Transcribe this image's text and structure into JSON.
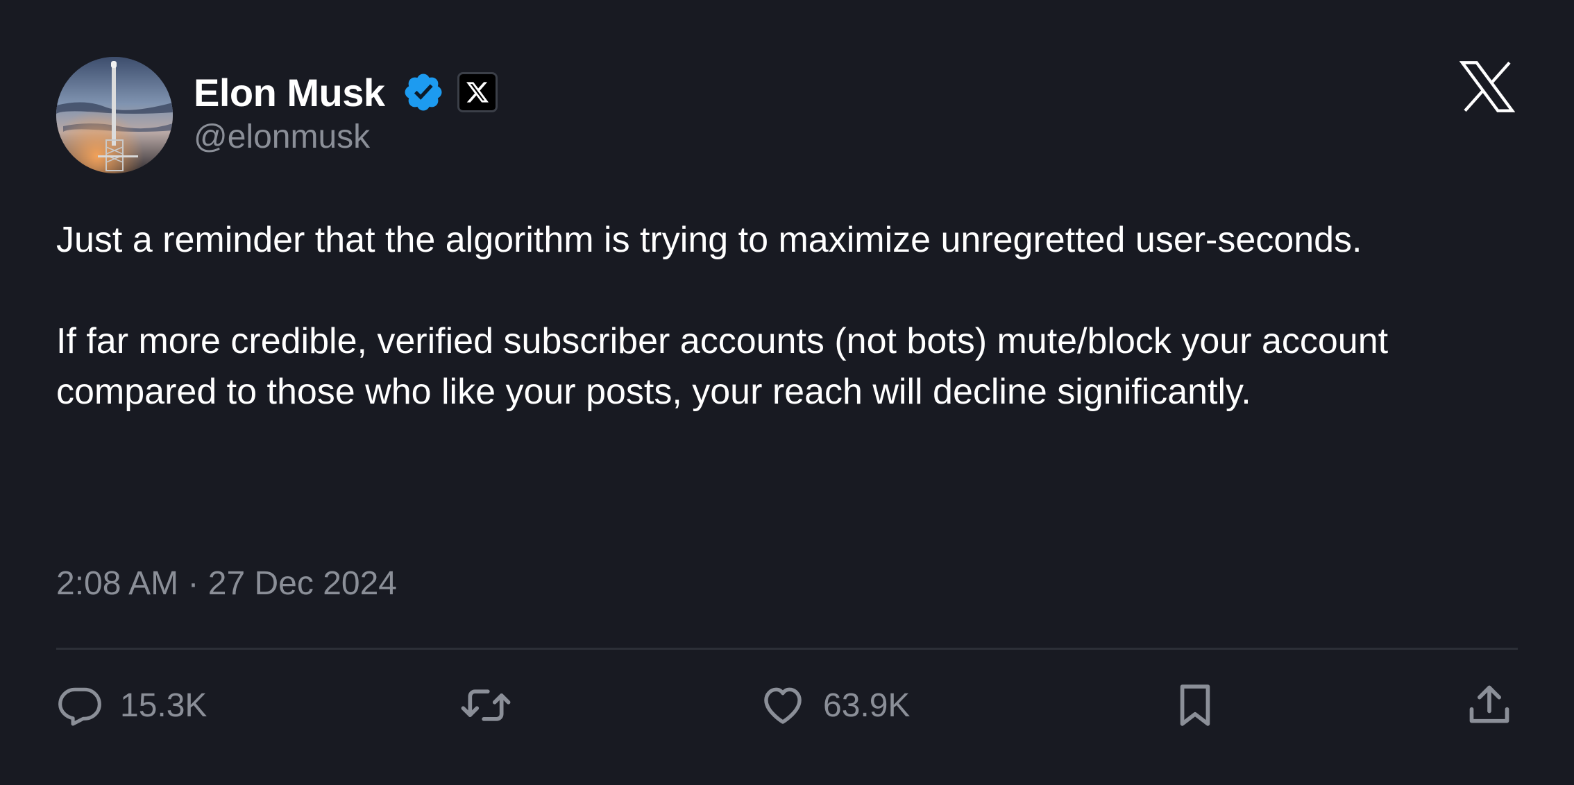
{
  "author": {
    "name": "Elon Musk",
    "handle": "@elonmusk",
    "verified": true,
    "affiliate_badge_icon": "x-logo-icon",
    "avatar_icon": "starship-launch-avatar"
  },
  "tweet": {
    "paragraphs": [
      "Just a reminder that the algorithm is trying to maximize unregretted user-seconds.",
      "If far more credible, verified subscriber accounts (not bots) mute/block your account compared to those who like your posts, your reach will decline significantly."
    ],
    "timestamp": "2:08 AM · 27 Dec 2024"
  },
  "actions": {
    "reply": {
      "icon": "reply-icon",
      "count": "15.3K"
    },
    "repost": {
      "icon": "repost-icon"
    },
    "like": {
      "icon": "heart-icon",
      "count": "63.9K"
    },
    "bookmark": {
      "icon": "bookmark-icon"
    },
    "share": {
      "icon": "share-icon"
    }
  },
  "colors": {
    "background": "#181a22",
    "text": "#ffffff",
    "muted": "#8b8f98",
    "verified_blue": "#1d9bf0",
    "divider": "#2c2f37"
  }
}
